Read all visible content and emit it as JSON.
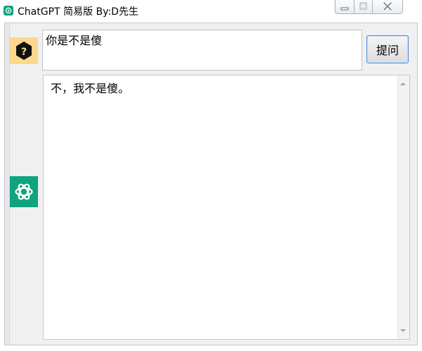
{
  "window": {
    "title": "ChatGPT 简易版  By:D先生",
    "icon": "chatgpt-logo-icon",
    "controls": [
      "minimize-icon",
      "maximize-icon",
      "close-icon"
    ]
  },
  "question": {
    "avatar_icon": "question-mark-icon",
    "avatar_color": "#fcd88c",
    "value": "你是不是傻"
  },
  "ask_button": {
    "label": "提问"
  },
  "answer": {
    "avatar_icon": "chatgpt-logo-icon",
    "avatar_color": "#10a37f",
    "text": "不，我不是傻。"
  },
  "colors": {
    "accent_green": "#10a37f",
    "button_border": "#4f8fd9"
  }
}
